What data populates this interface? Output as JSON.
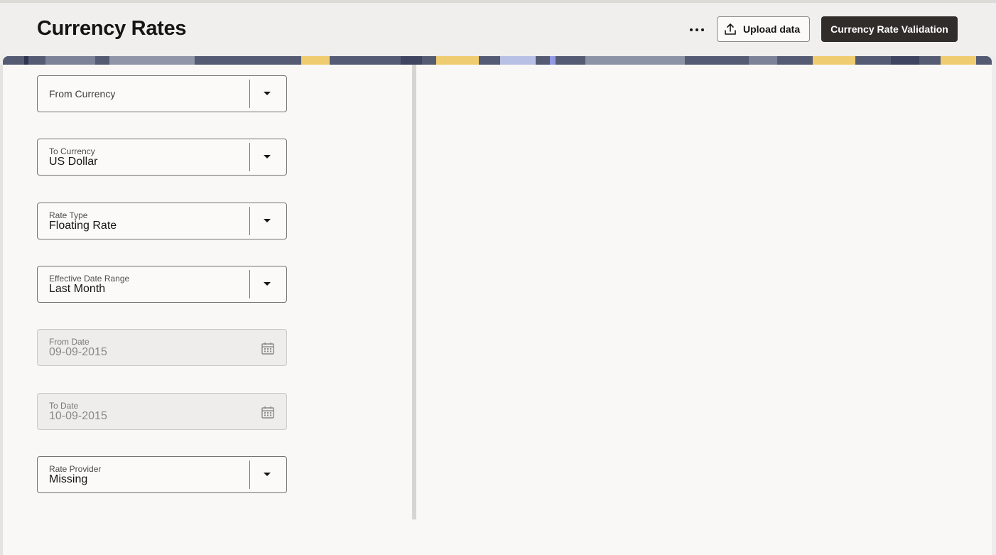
{
  "header": {
    "title": "Currency Rates",
    "more_icon": "ellipsis-icon",
    "upload_label": "Upload data",
    "upload_icon": "upload-icon",
    "validation_label": "Currency Rate Validation"
  },
  "filters": {
    "from_currency": {
      "label": "From Currency",
      "value": ""
    },
    "to_currency": {
      "label": "To Currency",
      "value": "US Dollar"
    },
    "rate_type": {
      "label": "Rate Type",
      "value": "Floating Rate"
    },
    "effective_date_range": {
      "label": "Effective Date Range",
      "value": "Last Month"
    },
    "from_date": {
      "label": "From Date",
      "value": "09-09-2015",
      "disabled": true
    },
    "to_date": {
      "label": "To Date",
      "value": "10-09-2015",
      "disabled": true
    },
    "rate_provider": {
      "label": "Rate Provider",
      "value": "Missing"
    }
  },
  "colors": {
    "primary_button": "#312d2a",
    "page_background": "#f9f8f6",
    "banner_accent_yellow": "#f0cc71",
    "banner_base": "#545b73"
  }
}
